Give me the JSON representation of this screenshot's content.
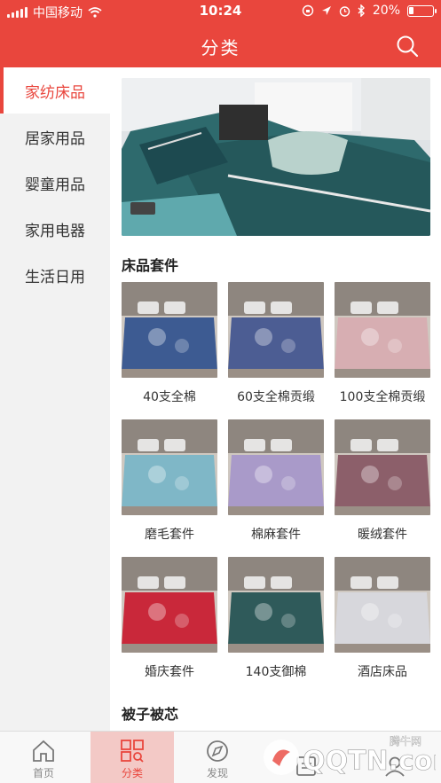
{
  "status_bar": {
    "carrier": "中国移动",
    "time": "10:24",
    "battery": "20%",
    "battery_level": 0.2
  },
  "header": {
    "title": "分类"
  },
  "sidebar": {
    "items": [
      {
        "label": "家纺床品",
        "active": true
      },
      {
        "label": "居家用品",
        "active": false
      },
      {
        "label": "婴童用品",
        "active": false
      },
      {
        "label": "家用电器",
        "active": false
      },
      {
        "label": "生活日用",
        "active": false
      }
    ]
  },
  "main": {
    "section1_title": "床品套件",
    "section2_title": "被子被芯",
    "products": [
      {
        "label": "40支全棉",
        "color": "#3d5b92"
      },
      {
        "label": "60支全棉贡缎",
        "color": "#4c5d93"
      },
      {
        "label": "100支全棉贡缎",
        "color": "#d7aeb2"
      },
      {
        "label": "磨毛套件",
        "color": "#7fb7c7"
      },
      {
        "label": "棉麻套件",
        "color": "#a99ac9"
      },
      {
        "label": "暖绒套件",
        "color": "#8c5f6a"
      },
      {
        "label": "婚庆套件",
        "color": "#c9283a"
      },
      {
        "label": "140支御棉",
        "color": "#2f5a5a"
      },
      {
        "label": "酒店床品",
        "color": "#d7d7dc"
      }
    ]
  },
  "bottom_nav": {
    "tabs": [
      {
        "label": "首页",
        "icon": "home-icon"
      },
      {
        "label": "分类",
        "icon": "category-grid-icon",
        "active": true
      },
      {
        "label": "发现",
        "icon": "discover-icon"
      },
      {
        "label": "",
        "icon": "list-icon"
      },
      {
        "label": "",
        "icon": "user-icon"
      }
    ]
  },
  "watermark": {
    "text": "QQTN.com",
    "sub": "腾牛网"
  },
  "colors": {
    "brand_red": "#e9463d",
    "banner_teal": "#2e6a6d"
  }
}
